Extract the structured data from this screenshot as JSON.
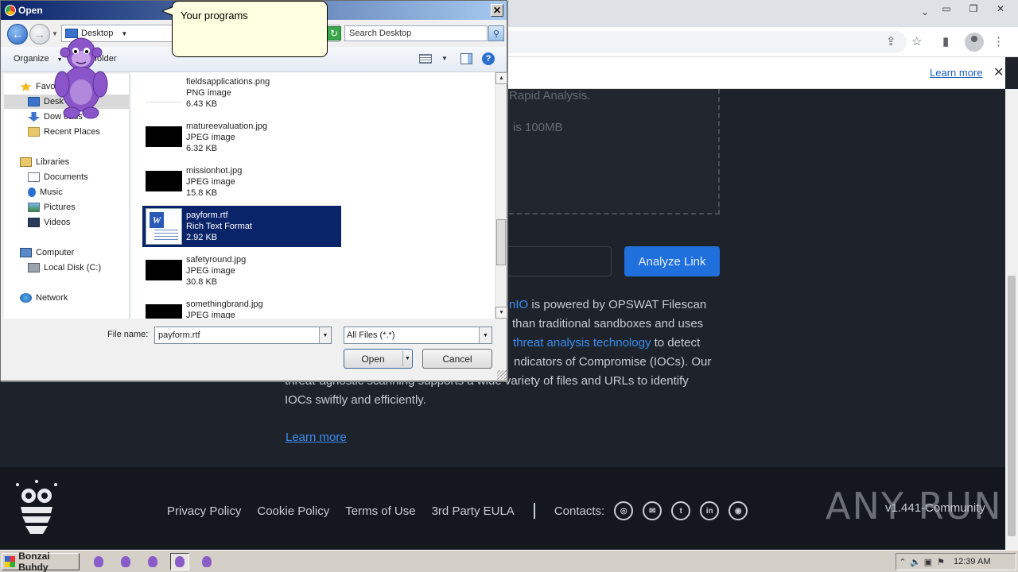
{
  "browser": {
    "cookie_learn_more": "Learn more",
    "close_symbol": "✕"
  },
  "page": {
    "dropzone_line1": "Rapid Analysis.",
    "dropzone_line2": "is 100MB",
    "analyze_button": "Analyze Link",
    "para_line1_link": "nIO",
    "para_line1_rest": " is powered by OPSWAT Filescan",
    "para_line2": "than traditional sandboxes and uses",
    "para_line3_link": "threat analysis technology",
    "para_line3_rest": " to detect",
    "para_line4": "ndicators of Compromise (IOCs). Our",
    "para_line5": "threat-agnostic scanning supports a wide variety of files and URLs to identify",
    "para_line6": "IOCs swiftly and efficiently.",
    "learn_more": "Learn more"
  },
  "footer": {
    "links": [
      "Privacy Policy",
      "Cookie Policy",
      "Terms of Use",
      "3rd Party EULA"
    ],
    "contacts_label": "Contacts:",
    "brand": "ANY RUN",
    "version": "v1.441-Community"
  },
  "dialog": {
    "title": "Open",
    "location": "Desktop",
    "search_placeholder": "Search Desktop",
    "organize": "Organize",
    "new_folder": "folder",
    "nav": {
      "favorites": "Favo",
      "desktop": "Desk",
      "downloads": "Dow  oads",
      "recent": "Recent Places",
      "libraries": "Libraries",
      "documents": "Documents",
      "music": "Music",
      "pictures": "Pictures",
      "videos": "Videos",
      "computer": "Computer",
      "local_disk": "Local Disk (C:)",
      "network": "Network"
    },
    "files": [
      {
        "name": "fieldsapplications.png",
        "type": "PNG image",
        "size": "6.43 KB"
      },
      {
        "name": "matureevaluation.jpg",
        "type": "JPEG image",
        "size": "6.32 KB"
      },
      {
        "name": "missionhot.jpg",
        "type": "JPEG image",
        "size": "15.8 KB"
      },
      {
        "name": "payform.rtf",
        "type": "Rich Text Format",
        "size": "2.92 KB"
      },
      {
        "name": "safetyround.jpg",
        "type": "JPEG image",
        "size": "30.8 KB"
      },
      {
        "name": "somethingbrand.jpg",
        "type": "JPEG image",
        "size": ""
      }
    ],
    "file_name_label": "File name:",
    "file_name_value": "payform.rtf",
    "file_type": "All Files (*.*)",
    "open_button": "Open",
    "cancel_button": "Cancel"
  },
  "bonzi": {
    "tooltip": "Your programs"
  },
  "taskbar": {
    "start_label": "Bonzai Buhdy",
    "clock": "12:39 AM"
  }
}
